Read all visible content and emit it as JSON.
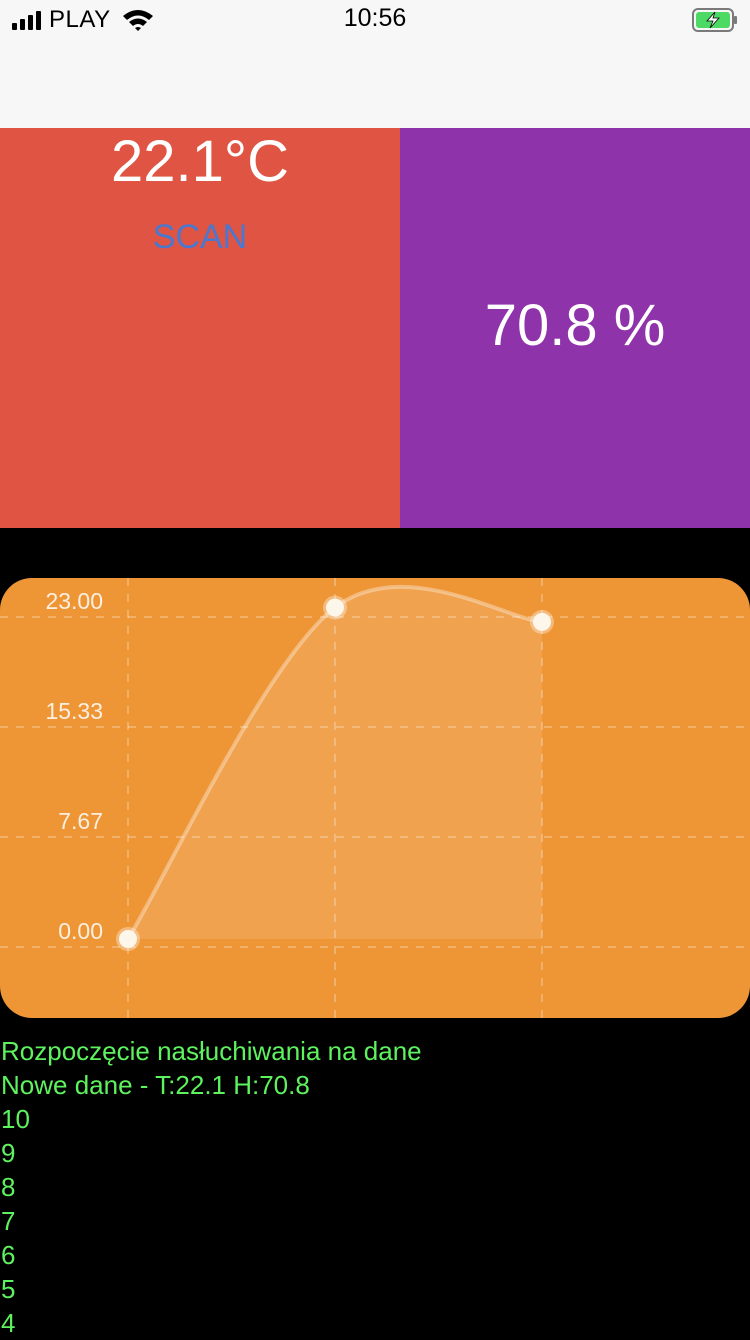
{
  "status_bar": {
    "carrier": "PLAY",
    "time": "10:56",
    "signal_icon": "signal-bars-icon",
    "wifi_icon": "wifi-icon",
    "battery_icon": "battery-charging-icon"
  },
  "tiles": {
    "temperature": "22.1°C",
    "scan_label": "SCAN",
    "humidity": "70.8 %"
  },
  "colors": {
    "temperature_tile": "#e05443",
    "humidity_tile": "#8e33aa",
    "chart_background": "#ee9636",
    "scan_text": "#4a78cf",
    "log_text": "#5ef25e"
  },
  "chart_data": {
    "type": "area",
    "x": [
      0,
      1,
      2
    ],
    "values": [
      0,
      23.1,
      22.1
    ],
    "ylim": [
      0,
      23
    ],
    "y_ticks": [
      "0.00",
      "7.67",
      "15.33",
      "23.00"
    ],
    "y_tick_values": [
      0,
      7.67,
      15.33,
      23
    ],
    "grid": true,
    "title": "",
    "xlabel": "",
    "ylabel": ""
  },
  "log": [
    "Rozpoczęcie nasłuchiwania na dane",
    "Nowe dane - T:22.1 H:70.8",
    "10",
    "9",
    "8",
    "7",
    "6",
    "5",
    "4"
  ]
}
